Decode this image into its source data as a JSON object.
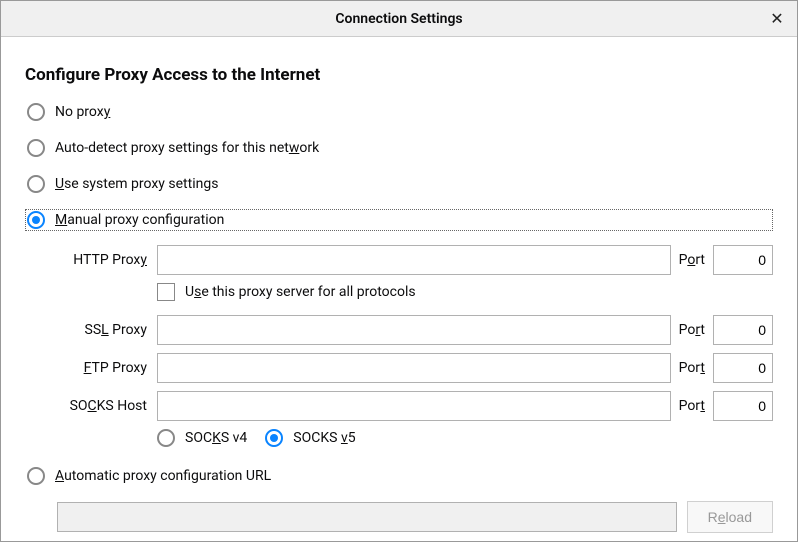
{
  "titlebar": {
    "title": "Connection Settings"
  },
  "section": {
    "heading": "Configure Proxy Access to the Internet"
  },
  "radios": {
    "no_proxy": {
      "pre": "No prox",
      "u": "y",
      "post": ""
    },
    "auto_detect": {
      "pre": "Auto-detect proxy settings for this net",
      "u": "w",
      "post": "ork"
    },
    "system": {
      "pre": "",
      "u": "U",
      "post": "se system proxy settings"
    },
    "manual": {
      "pre": "",
      "u": "M",
      "post": "anual proxy configuration"
    },
    "auto_url": {
      "pre": "",
      "u": "A",
      "post": "utomatic proxy configuration URL"
    }
  },
  "proxy": {
    "http_label": {
      "pre": "HTTP Prox",
      "u": "y",
      "post": ""
    },
    "ssl_label": {
      "pre": "SS",
      "u": "L",
      "post": " Proxy"
    },
    "ftp_label": {
      "pre": "",
      "u": "F",
      "post": "TP Proxy"
    },
    "socks_label": {
      "pre": "SO",
      "u": "C",
      "post": "KS Host"
    },
    "port_http": {
      "pre": "P",
      "u": "o",
      "post": "rt"
    },
    "port_ssl": {
      "pre": "Po",
      "u": "r",
      "post": "t"
    },
    "port_ftp": {
      "pre": "Por",
      "u": "t",
      "post": ""
    },
    "port_socks": {
      "pre": "Por",
      "u": "t",
      "post": ""
    },
    "http_value": "",
    "ssl_value": "",
    "ftp_value": "",
    "socks_value": "",
    "http_port": "0",
    "ssl_port": "0",
    "ftp_port": "0",
    "socks_port": "0"
  },
  "checkbox": {
    "use_all": {
      "pre": "U",
      "u": "s",
      "post": "e this proxy server for all protocols"
    }
  },
  "socks_version": {
    "v4": {
      "pre": "SOC",
      "u": "K",
      "post": "S v4"
    },
    "v5": {
      "pre": "SOCKS ",
      "u": "v",
      "post": "5"
    }
  },
  "buttons": {
    "reload": {
      "pre": "R",
      "u": "e",
      "post": "load"
    }
  }
}
